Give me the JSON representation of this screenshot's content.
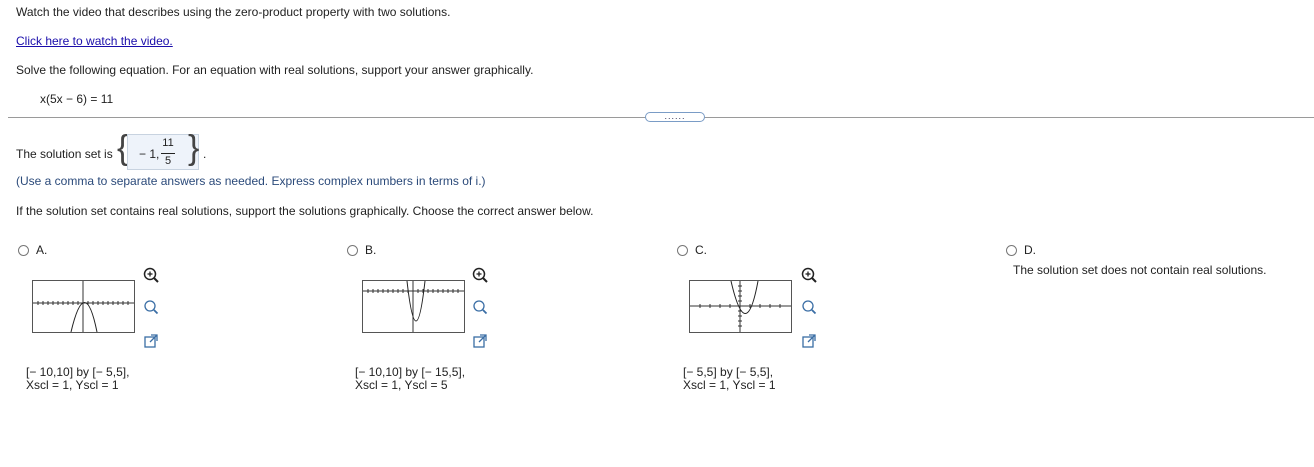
{
  "instructions": {
    "video_prompt": "Watch the video that describes using the zero-product property with two solutions.",
    "video_link": "Click here to watch the video.",
    "solve_prompt": "Solve the following equation. For an equation with real solutions, support your answer graphically.",
    "equation": "x(5x − 6) = 11"
  },
  "more_button": "......",
  "answer": {
    "lead_text": "The solution set is",
    "first_value": "− 1,",
    "numerator": "11",
    "denominator": "5",
    "trailing": ".",
    "hint": "(Use a comma to separate answers as needed. Express complex numbers in terms of i.)"
  },
  "question2": {
    "prompt": "If the solution set contains real solutions, support the solutions graphically. Choose the correct answer below."
  },
  "options": [
    {
      "letter": "A.",
      "window": "[− 10,10] by [− 5,5],",
      "scale": "Xscl = 1, Yscl = 1"
    },
    {
      "letter": "B.",
      "window": "[− 10,10] by [− 15,5],",
      "scale": "Xscl = 1, Yscl = 5"
    },
    {
      "letter": "C.",
      "window": "[− 5,5] by [− 5,5],",
      "scale": "Xscl = 1, Yscl = 1"
    },
    {
      "letter": "D.",
      "text": "The solution set does not contain real solutions."
    }
  ],
  "icons": [
    "zoom-in-icon",
    "zoom-out-icon",
    "popout-icon"
  ]
}
